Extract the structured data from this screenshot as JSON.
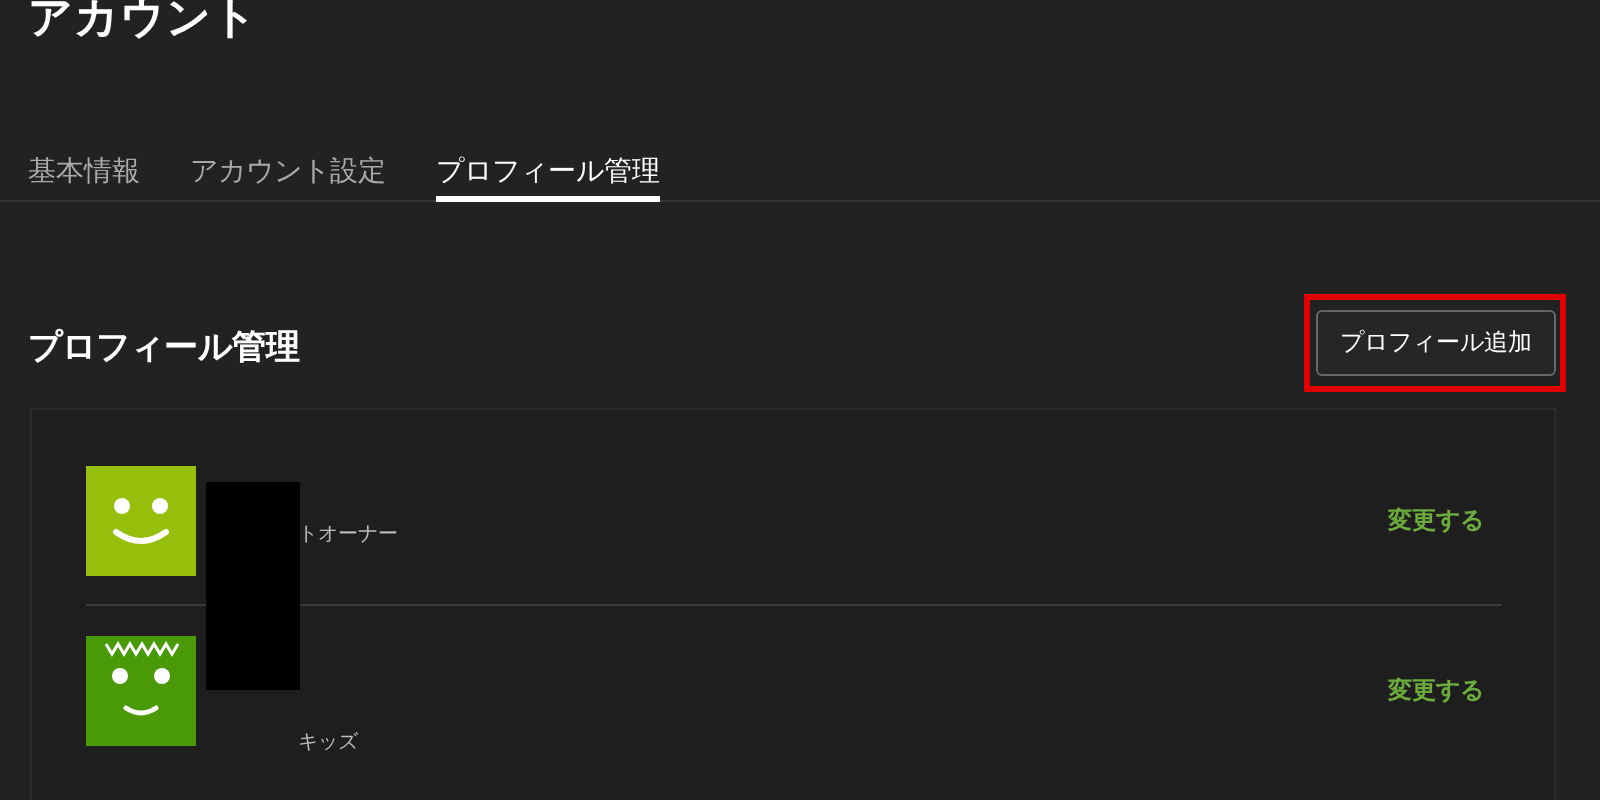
{
  "page_title": "アカウント",
  "tabs": [
    {
      "label": "基本情報",
      "selected": false
    },
    {
      "label": "アカウント設定",
      "selected": false
    },
    {
      "label": "プロフィール管理",
      "selected": true
    }
  ],
  "section": {
    "title": "プロフィール管理",
    "add_button": "プロフィール追加",
    "add_button_highlighted": true
  },
  "profiles": [
    {
      "kind": "smile",
      "color": "#95bf0a",
      "subtitle": "トオーナー",
      "action": "変更する"
    },
    {
      "kind": "kids",
      "color": "#4a9a08",
      "subtitle": "キッズ",
      "action": "変更する"
    }
  ]
}
